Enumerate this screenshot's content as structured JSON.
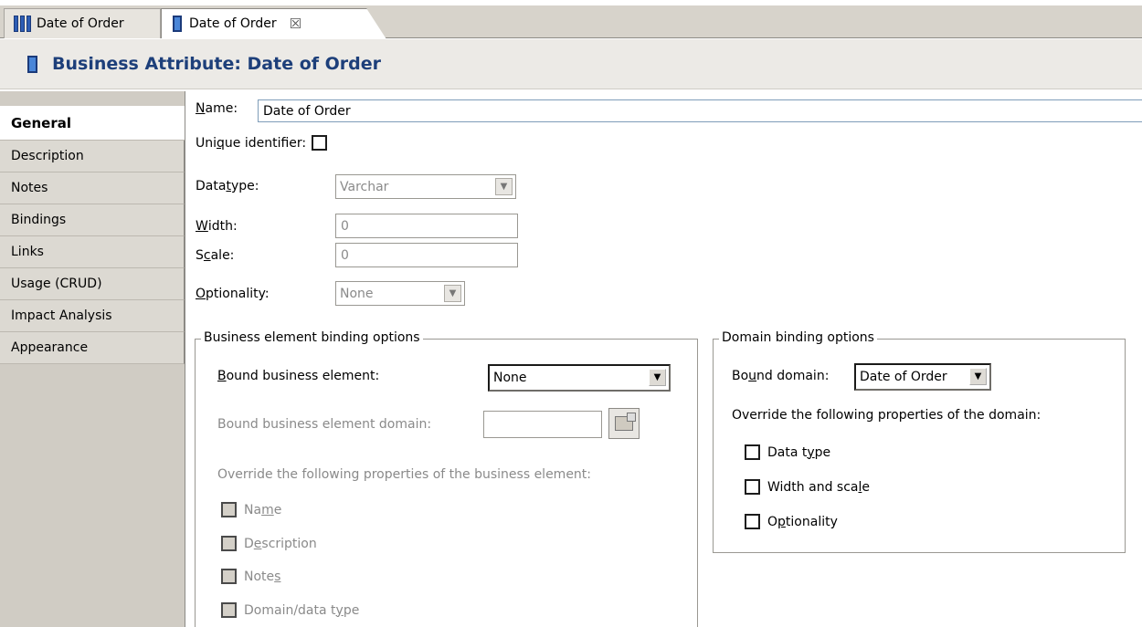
{
  "tabs": [
    {
      "label": "Date of Order",
      "icon": "entity-columns-icon"
    },
    {
      "label": "Date of Order",
      "icon": "attribute-icon",
      "close": "☒"
    }
  ],
  "header": {
    "title": "Business Attribute: Date of Order"
  },
  "nav": {
    "items": [
      "General",
      "Description",
      "Notes",
      "Bindings",
      "Links",
      "Usage (CRUD)",
      "Impact Analysis",
      "Appearance"
    ]
  },
  "form": {
    "name_label_u": "N",
    "name_label_rest": "ame:",
    "name_value": "Date of Order",
    "unique_pre": "Uni",
    "unique_u": "q",
    "unique_post": "ue identifier:",
    "datatype_pre": "Data ",
    "datatype_u": "t",
    "datatype_post": "ype:",
    "datatype_value": "Varchar",
    "width_u": "W",
    "width_post": "idth:",
    "width_value": "0",
    "scale_pre": "S",
    "scale_u": "c",
    "scale_post": "ale:",
    "scale_value": "0",
    "optionality_u": "O",
    "optionality_post": "ptionality:",
    "optionality_value": "None"
  },
  "business_group": {
    "title": "Business element binding options",
    "bound_element_u": "B",
    "bound_element_post": "ound business element:",
    "bound_element_value": "None",
    "bound_domain_label": "Bound business element domain:",
    "override_label": "Override the following properties of the business element:",
    "name_pre": "Na",
    "name_u": "m",
    "name_post": "e",
    "desc_pre": "D",
    "desc_u": "e",
    "desc_post": "scription",
    "notes_pre": "Note",
    "notes_u": "s",
    "notes_post": "",
    "domain_type_pre": "Domain/data t",
    "domain_type_u": "y",
    "domain_type_post": "pe"
  },
  "domain_group": {
    "title": "Domain binding options",
    "bound_domain_pre": "Bo",
    "bound_domain_u": "u",
    "bound_domain_post": "nd domain:",
    "bound_domain_value": "Date of Order",
    "override_label": "Override the following properties of the domain:",
    "datatype_pre": "Data t",
    "datatype_u": "y",
    "datatype_post": "pe",
    "width_pre": "Width and sca",
    "width_u": "l",
    "width_post": "e",
    "opt_pre": "O",
    "opt_u": "p",
    "opt_post": "tionality"
  }
}
